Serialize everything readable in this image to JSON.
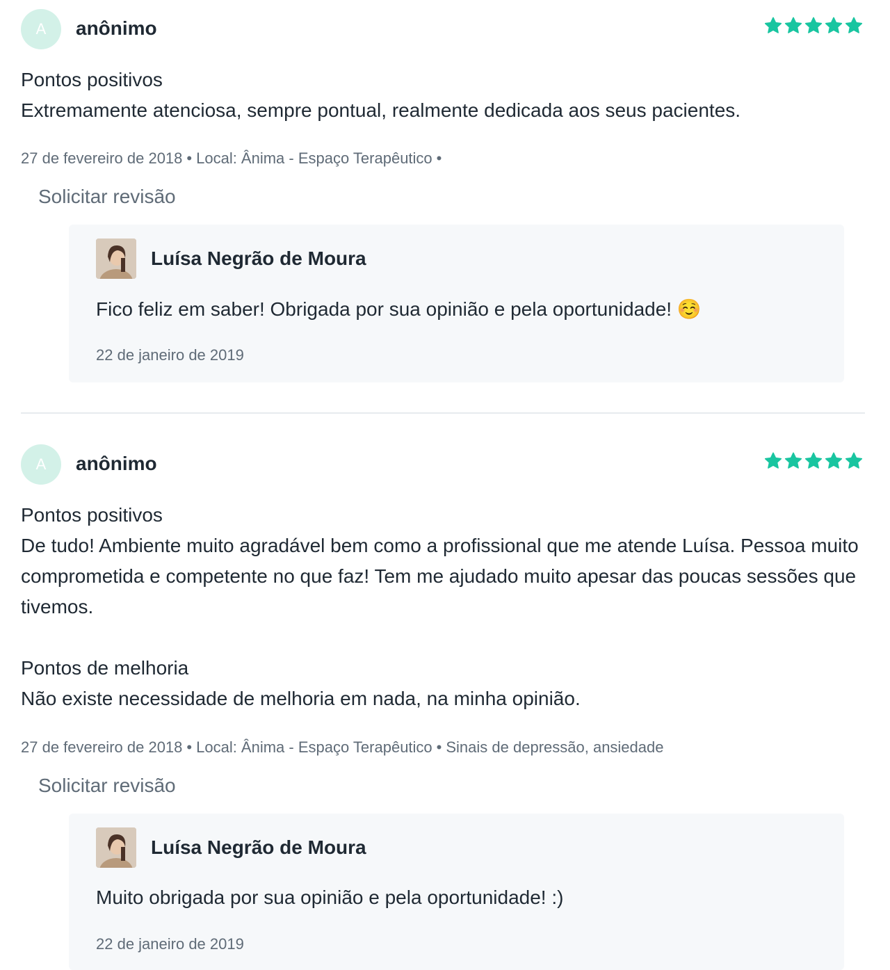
{
  "colors": {
    "star": "#19c5a0",
    "avatar_bg": "#d3f1e8",
    "reply_bg": "#f6f8fa",
    "muted_text": "#5f6b77"
  },
  "reviews": [
    {
      "avatar_letter": "A",
      "author": "anônimo",
      "rating": 5,
      "positive_title": "Pontos positivos",
      "positive_text": "Extremamente atenciosa, sempre pontual, realmente dedicada aos seus pacientes.",
      "meta_date": "27 de fevereiro de 2018",
      "meta_location": "Local: Ânima - Espaço Terapêutico",
      "meta_tags": "",
      "revise_label": "Solicitar revisão",
      "reply": {
        "name": "Luísa Negrão de Moura",
        "text": "Fico feliz em saber! Obrigada por sua opinião e pela oportunidade! ☺️",
        "date": "22 de janeiro de 2019"
      }
    },
    {
      "avatar_letter": "A",
      "author": "anônimo",
      "rating": 5,
      "positive_title": "Pontos positivos",
      "positive_text": "De tudo! Ambiente muito agradável bem como a profissional que me atende Luísa. Pessoa muito comprometida e competente no que faz! Tem me ajudado muito apesar das poucas sessões que tivemos.",
      "improvement_title": "Pontos de melhoria",
      "improvement_text": "Não existe necessidade de melhoria em nada, na minha opinião.",
      "meta_date": "27 de fevereiro de 2018",
      "meta_location": "Local: Ânima - Espaço Terapêutico",
      "meta_tags": "Sinais de depressão, ansiedade",
      "revise_label": "Solicitar revisão",
      "reply": {
        "name": "Luísa Negrão de Moura",
        "text": "Muito obrigada por sua opinião e pela oportunidade! :)",
        "date": "22 de janeiro de 2019"
      }
    }
  ]
}
